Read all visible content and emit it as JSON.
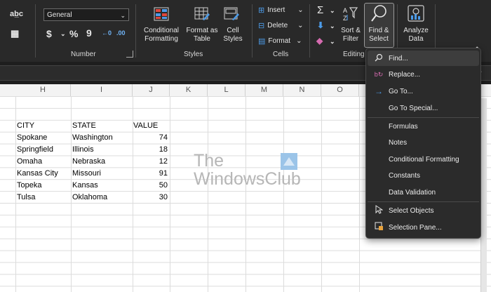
{
  "ribbon": {
    "number": {
      "format_value": "General",
      "currency_symbol": "$",
      "percent_symbol": "%",
      "comma_symbol": "9",
      "group_label": "Number"
    },
    "styles": {
      "conditional_formatting": "Conditional Formatting",
      "format_as_table": "Format as Table",
      "cell_styles": "Cell Styles",
      "group_label": "Styles"
    },
    "cells": {
      "insert": "Insert",
      "delete": "Delete",
      "format": "Format",
      "group_label": "Cells"
    },
    "editing": {
      "sort_filter": "Sort & Filter",
      "find_select": "Find & Select",
      "group_label": "Editing"
    },
    "analysis": {
      "analyze_data": "Analyze Data"
    }
  },
  "sheet": {
    "columns": [
      "H",
      "I",
      "J",
      "K",
      "L",
      "M",
      "N",
      "O"
    ],
    "headers": [
      "CITY",
      "STATE",
      "VALUE"
    ],
    "rows": [
      {
        "city": "Spokane",
        "state": "Washington",
        "value": "74"
      },
      {
        "city": "Springfield",
        "state": "Illinois",
        "value": "18"
      },
      {
        "city": "Omaha",
        "state": "Nebraska",
        "value": "12"
      },
      {
        "city": "Kansas City",
        "state": "Missouri",
        "value": "91"
      },
      {
        "city": "Topeka",
        "state": "Kansas",
        "value": "50"
      },
      {
        "city": "Tulsa",
        "state": "Oklahoma",
        "value": "30"
      }
    ]
  },
  "watermark": {
    "line1": "The",
    "line2": "WindowsClub"
  },
  "menu": {
    "items": [
      {
        "label": "Find...",
        "icon": "search-icon"
      },
      {
        "label": "Replace...",
        "icon": "replace-icon"
      },
      {
        "label": "Go To...",
        "icon": "arrow-right-icon"
      },
      {
        "label": "Go To Special...",
        "icon": ""
      },
      {
        "label": "Formulas",
        "icon": ""
      },
      {
        "label": "Notes",
        "icon": ""
      },
      {
        "label": "Conditional Formatting",
        "icon": ""
      },
      {
        "label": "Constants",
        "icon": ""
      },
      {
        "label": "Data Validation",
        "icon": ""
      },
      {
        "label": "Select Objects",
        "icon": "pointer-icon"
      },
      {
        "label": "Selection Pane...",
        "icon": "selection-pane-icon"
      }
    ]
  },
  "colors": {
    "ribbon_bg": "#292929",
    "accent_blue": "#4c9be8"
  }
}
